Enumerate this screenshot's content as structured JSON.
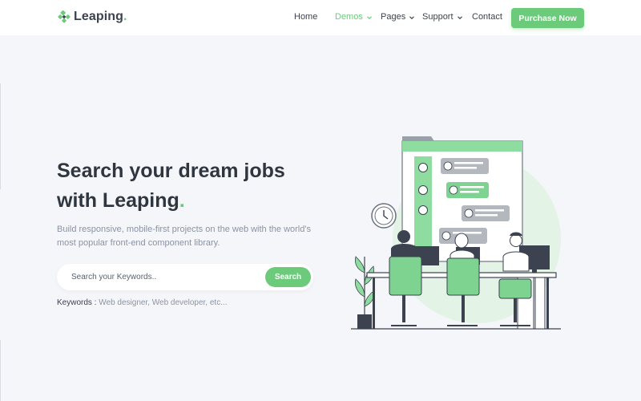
{
  "brand": {
    "name": "Leaping",
    "dot": ".",
    "accent": "#6bcb7b"
  },
  "nav": {
    "items": [
      {
        "label": "Home",
        "active": false,
        "dropdown": false
      },
      {
        "label": "Demos",
        "active": true,
        "dropdown": true
      },
      {
        "label": "Pages",
        "active": false,
        "dropdown": true
      },
      {
        "label": "Support",
        "active": false,
        "dropdown": true
      },
      {
        "label": "Contact",
        "active": false,
        "dropdown": false
      }
    ],
    "cta": "Purchase Now"
  },
  "hero": {
    "title_line1": "Search your dream jobs",
    "title_line2": "with Leaping",
    "title_dot": ".",
    "description": "Build responsive, mobile-first projects on the web with the world's most popular front-end component library.",
    "search": {
      "placeholder": "Search your Keywords..",
      "button": "Search"
    },
    "keywords_label": "Keywords :",
    "keywords_value": " Web designer, Web developer, etc..."
  },
  "icons": {
    "logo": "diamond-logo-icon",
    "dropdown": "chevron-down-icon"
  }
}
